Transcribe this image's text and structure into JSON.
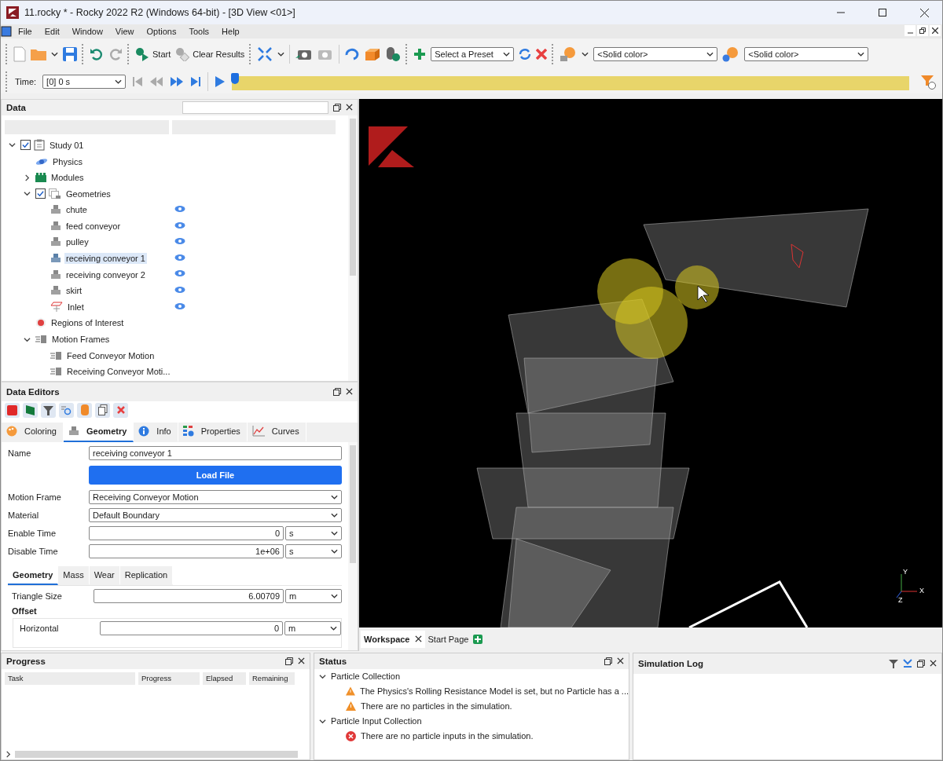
{
  "window": {
    "title": "11.rocky * - Rocky 2022 R2 (Windows 64-bit) - [3D View <01>]"
  },
  "menu": [
    "File",
    "Edit",
    "Window",
    "View",
    "Options",
    "Tools",
    "Help"
  ],
  "toolbar": {
    "start": "Start",
    "clear_results": "Clear Results",
    "preset": "Select a Preset",
    "color_1": "<Solid color>",
    "color_2": "<Solid color>"
  },
  "timebar": {
    "label": "Time:",
    "value": "[0] 0 s",
    "level": 0
  },
  "data_panel": {
    "title": "Data",
    "tree": [
      {
        "label": "Study 01",
        "kind": "study",
        "checked": true,
        "expanded": true,
        "children": [
          {
            "label": "Physics",
            "kind": "physics"
          },
          {
            "label": "Modules",
            "kind": "modules",
            "expanded": false
          },
          {
            "label": "Geometries",
            "kind": "geometries",
            "checked": true,
            "expanded": true,
            "children": [
              {
                "label": "chute",
                "kind": "geometry",
                "visible": true
              },
              {
                "label": "feed conveyor",
                "kind": "geometry",
                "visible": true
              },
              {
                "label": "pulley",
                "kind": "geometry",
                "visible": true
              },
              {
                "label": "receiving conveyor 1",
                "kind": "geometry",
                "selected": true,
                "visible": true
              },
              {
                "label": "receiving conveyor 2",
                "kind": "geometry",
                "visible": true
              },
              {
                "label": "skirt",
                "kind": "geometry",
                "visible": true
              },
              {
                "label": "Inlet",
                "kind": "inlet",
                "visible": true
              }
            ]
          },
          {
            "label": "Regions of Interest",
            "kind": "regions"
          },
          {
            "label": "Motion Frames",
            "kind": "frames",
            "expanded": true,
            "children": [
              {
                "label": "Feed Conveyor Motion",
                "kind": "frame"
              },
              {
                "label": "Receiving Conveyor Moti...",
                "kind": "frame"
              }
            ]
          }
        ]
      }
    ]
  },
  "data_editors": {
    "title": "Data Editors",
    "tabs": [
      {
        "label": "Coloring",
        "kind": "coloring",
        "selected": false
      },
      {
        "label": "Geometry",
        "kind": "geometry",
        "selected": true
      },
      {
        "label": "Info",
        "kind": "info",
        "selected": false
      },
      {
        "label": "Properties",
        "kind": "properties",
        "selected": false
      },
      {
        "label": "Curves",
        "kind": "curves",
        "selected": false
      }
    ],
    "name_label": "Name",
    "name_value": "receiving conveyor 1",
    "load_file": "Load File",
    "motion_frame": {
      "label": "Motion Frame",
      "value": "Receiving Conveyor Motion"
    },
    "material": {
      "label": "Material",
      "value": "Default Boundary"
    },
    "enable_time": {
      "label": "Enable Time",
      "value": "0",
      "unit": "s"
    },
    "disable_time": {
      "label": "Disable Time",
      "value": "1e+06",
      "unit": "s"
    },
    "subtabs": [
      {
        "label": "Geometry",
        "selected": true
      },
      {
        "label": "Mass",
        "selected": false
      },
      {
        "label": "Wear",
        "selected": false
      },
      {
        "label": "Replication",
        "selected": false
      }
    ],
    "triangle_size": {
      "label": "Triangle Size",
      "value": "6.00709",
      "unit": "m"
    },
    "offset": {
      "title": "Offset",
      "horizontal": {
        "label": "Horizontal",
        "value": "0",
        "unit": "m"
      }
    }
  },
  "view": {
    "axes": [
      "Y",
      "X",
      "Z"
    ]
  },
  "workspace_tabs": [
    {
      "label": "Workspace",
      "selected": true,
      "kind": "close"
    },
    {
      "label": "Start Page",
      "selected": false,
      "kind": "add"
    }
  ],
  "progress": {
    "title": "Progress",
    "columns": [
      "Task",
      "Progress",
      "Elapsed",
      "Remaining"
    ]
  },
  "status": {
    "title": "Status",
    "groups": [
      {
        "label": "Particle Collection",
        "expanded": true,
        "items": [
          {
            "kind": "warning",
            "text": "The Physics's Rolling Resistance Model is set, but no Particle has a ..."
          },
          {
            "kind": "warning",
            "text": "There are no particles in the simulation."
          }
        ]
      },
      {
        "label": "Particle Input Collection",
        "expanded": true,
        "items": [
          {
            "kind": "error",
            "text": "There are no particle inputs in the simulation."
          }
        ]
      }
    ]
  },
  "simulation_log": {
    "title": "Simulation Log"
  }
}
